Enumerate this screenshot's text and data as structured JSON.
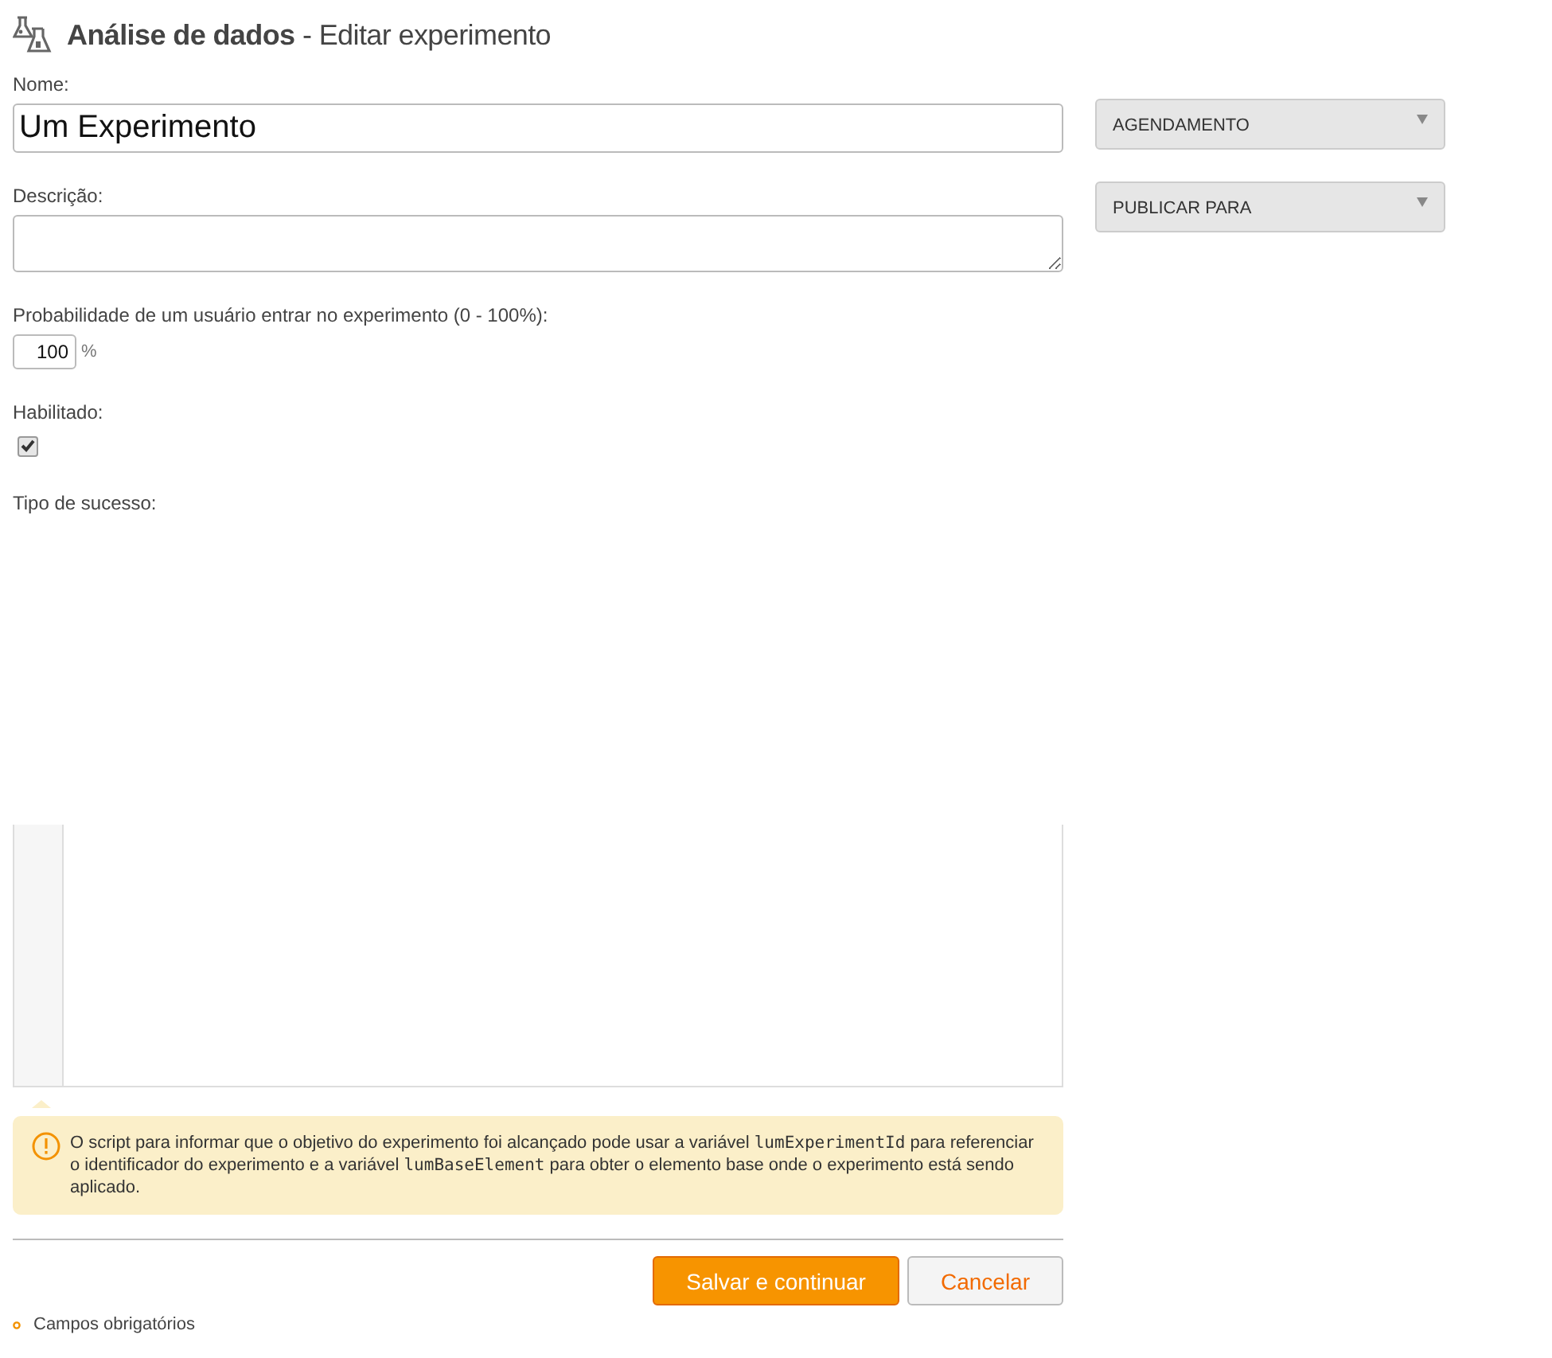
{
  "header": {
    "section": "Análise de dados",
    "separator": " - ",
    "title": "Editar experimento"
  },
  "fields": {
    "name": {
      "label": "Nome:",
      "value": "Um Experimento"
    },
    "description": {
      "label": "Descrição:"
    },
    "probability": {
      "label": "Probabilidade de um usuário entrar no experimento (0 - 100%):",
      "value": "100",
      "unit": "%"
    },
    "enabled": {
      "label": "Habilitado:",
      "checked": true
    },
    "success_type": {
      "label": "Tipo de sucesso:"
    }
  },
  "note": [
    {
      "kind": "text",
      "text": "O script para informar que o objetivo do experimento foi alcançado pode usar a variável "
    },
    {
      "kind": "code",
      "text": "lumExperimentId"
    },
    {
      "kind": "text",
      "text": " para referenciar o identificador do experimento e a variável "
    },
    {
      "kind": "code",
      "text": "lumBaseElement"
    },
    {
      "kind": "text",
      "text": " para obter o elemento base onde o experimento está sendo aplicado."
    }
  ],
  "buttons": [
    {
      "kind": "primary",
      "label": "Salvar e continuar"
    },
    {
      "kind": "secondary",
      "label": "Cancelar"
    }
  ],
  "required_note": "Campos obrigatórios",
  "side_panels": [
    {
      "label": "AGENDAMENTO",
      "expanded": false
    },
    {
      "label": "PUBLICAR PARA",
      "expanded": false
    }
  ]
}
